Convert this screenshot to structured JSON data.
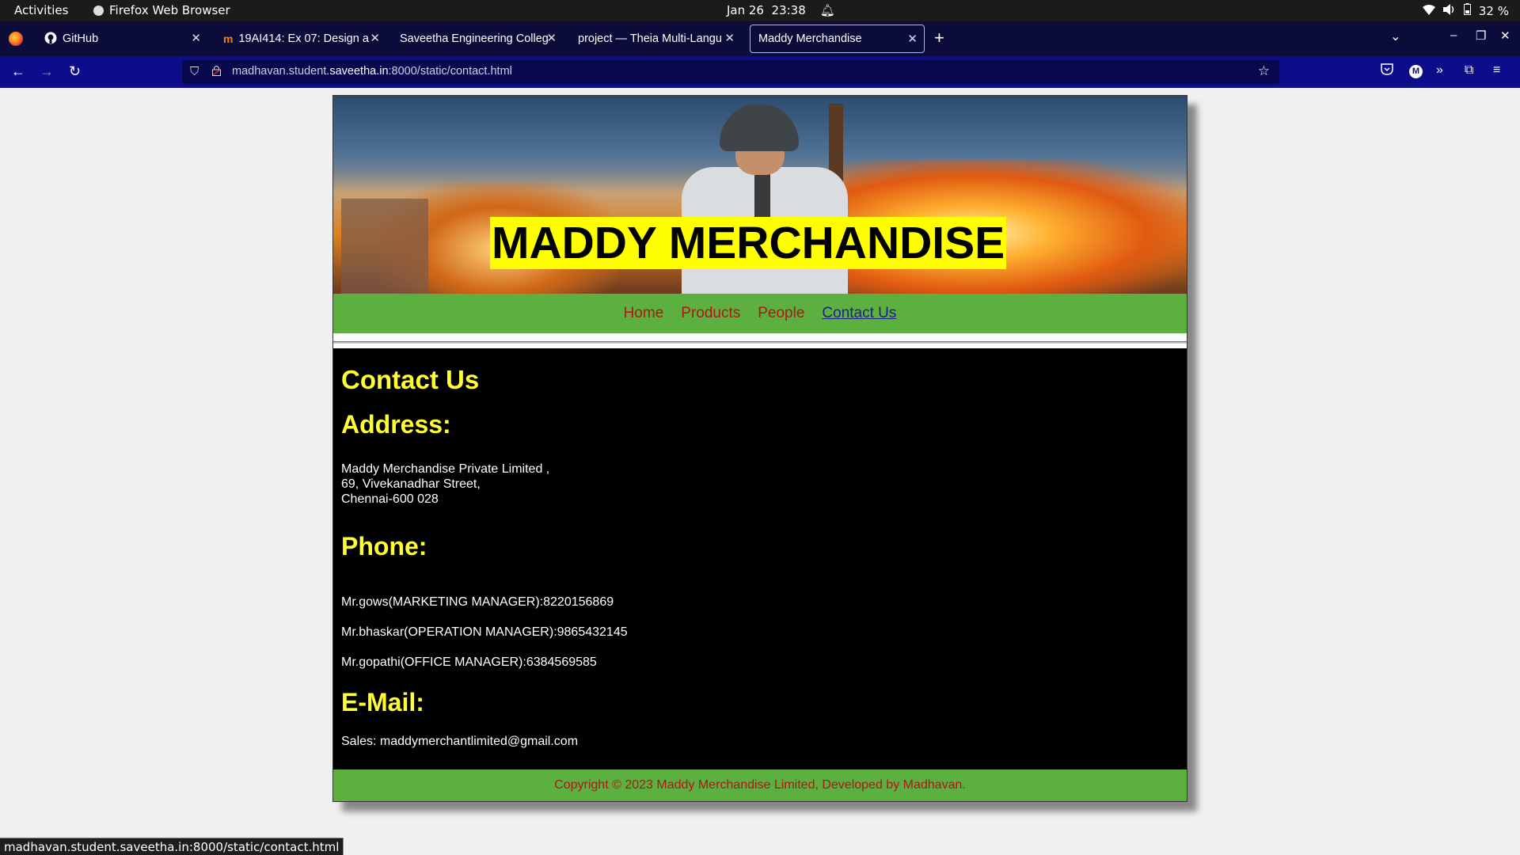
{
  "system": {
    "activities": "Activities",
    "app_name": "Firefox Web Browser",
    "date": "Jan 26",
    "time": "23:38",
    "battery": "32 %"
  },
  "tabs": [
    {
      "label": "GitHub",
      "icon": "github-icon"
    },
    {
      "label": "19AI414: Ex 07: Design a",
      "icon": "moodle-icon"
    },
    {
      "label": "Saveetha Engineering Colleg",
      "icon": "none"
    },
    {
      "label": "project — Theia Multi-Langu",
      "icon": "none"
    },
    {
      "label": "Maddy Merchandise",
      "icon": "none",
      "active": true
    }
  ],
  "url": {
    "prefix": "madhavan.student.",
    "domain": "saveetha.in",
    "suffix": ":8000/static/contact.html"
  },
  "site": {
    "title": "MADDY MERCHANDISE",
    "nav": [
      "Home",
      "Products",
      "People",
      "Contact Us"
    ],
    "heading": "Contact Us",
    "address_heading": "Address:",
    "address_lines": [
      "Maddy Merchandise Private Limited ,",
      "69, Vivekanadhar Street,",
      "Chennai-600 028"
    ],
    "phone_heading": "Phone:",
    "phones": [
      "Mr.gows(MARKETING MANAGER):8220156869",
      "Mr.bhaskar(OPERATION MANAGER):9865432145",
      "Mr.gopathi(OFFICE MANAGER):6384569585"
    ],
    "email_heading": "E-Mail:",
    "email": "Sales: maddymerchantlimited@gmail.com",
    "footer": "Copyright © 2023 Maddy Merchandise Limited, Developed by Madhavan."
  },
  "statusbar_url": "madhavan.student.saveetha.in:8000/static/contact.html",
  "colors": {
    "title_bg": "#ffff00",
    "menu_bg": "#5cb040",
    "link": "#b01616",
    "heading": "#ffff33"
  }
}
